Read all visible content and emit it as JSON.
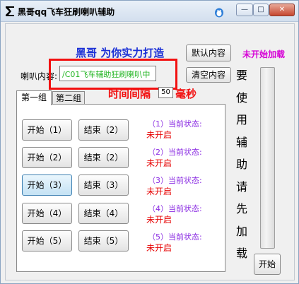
{
  "window": {
    "title": "黑哥qq飞车狂刷喇叭辅助",
    "buttons": {
      "minimize": "—",
      "maximize": "□",
      "close": "✕"
    }
  },
  "header": {
    "slogan": "黑哥  为你实力打造",
    "default_button": "默认内容",
    "clear_button": "清空内容",
    "load_status": "未开始加载"
  },
  "horn": {
    "label": "喇叭内容:",
    "value": "/C01飞车辅助狂刷喇叭中"
  },
  "interval": {
    "label": "时间间隔",
    "value": "50",
    "unit": "毫秒"
  },
  "tabs": [
    {
      "label": "第一组"
    },
    {
      "label": "第二组"
    }
  ],
  "groups": [
    {
      "start": "开始（1）",
      "end": "结束（2）",
      "state_label": "（1）当前状态:",
      "state": "未开启"
    },
    {
      "start": "开始（2）",
      "end": "结束（2）",
      "state_label": "（2）当前状态:",
      "state": "未开启"
    },
    {
      "start": "开始（3）",
      "end": "结束（3）",
      "state_label": "（3）当前状态:",
      "state": "未开启"
    },
    {
      "start": "开始（4）",
      "end": "结束（4）",
      "state_label": "（4）当前状态:",
      "state": "未开启"
    },
    {
      "start": "开始（5）",
      "end": "结束（5）",
      "state_label": "（5）当前状态:",
      "state": "未开启"
    }
  ],
  "side": {
    "vertical_text": [
      "要",
      "使",
      "用",
      "辅",
      "助",
      "请",
      "先",
      "加",
      "载"
    ],
    "start_button": "开始"
  },
  "colors": {
    "slogan": "#1a2fd6",
    "load_status": "#d600d6",
    "interval": "#f21010",
    "state_label": "#8a2be2",
    "state_value": "#e60000",
    "horn_text": "#22b522"
  }
}
